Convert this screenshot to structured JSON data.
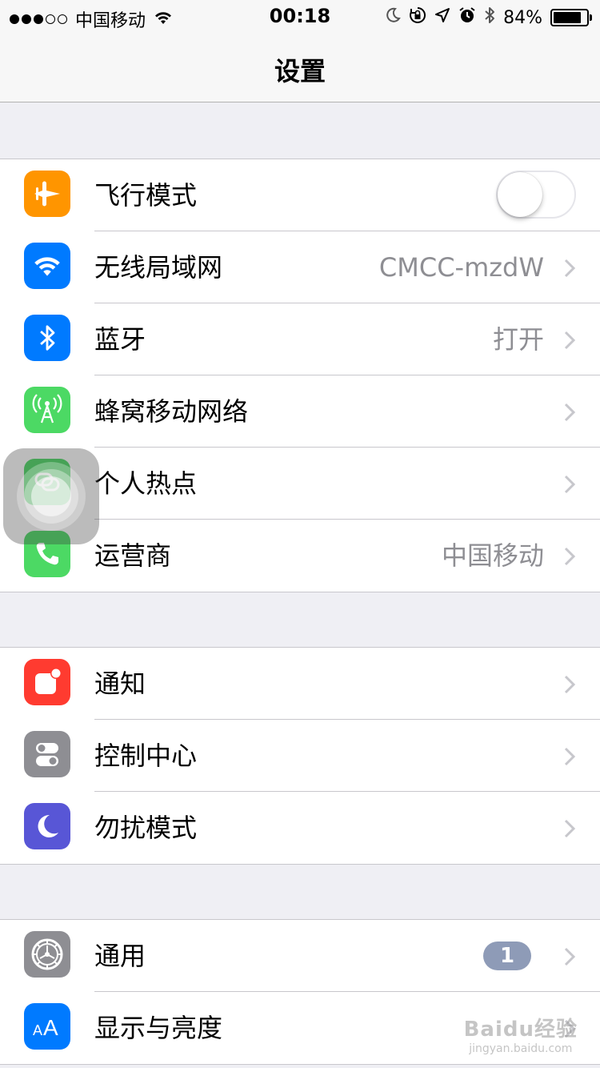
{
  "status_bar": {
    "carrier": "中国移动",
    "time": "00:18",
    "battery": "84%",
    "battery_level": 0.84,
    "signal_bars_filled": 3,
    "signal_bars_total": 5,
    "icons": [
      "wifi-icon",
      "moon-icon",
      "orientation-lock-icon",
      "location-icon",
      "alarm-icon",
      "bluetooth-icon",
      "battery-icon"
    ]
  },
  "nav": {
    "title": "设置"
  },
  "groups": [
    {
      "rows": [
        {
          "label": "飞行模式",
          "icon": "airplane-icon",
          "color": "#ff9500",
          "toggle": false
        },
        {
          "label": "无线局域网",
          "icon": "wifi-icon",
          "color": "#007aff",
          "value": "CMCC-mzdW"
        },
        {
          "label": "蓝牙",
          "icon": "bluetooth-icon",
          "color": "#007aff",
          "value": "打开"
        },
        {
          "label": "蜂窝移动网络",
          "icon": "cellular-icon",
          "color": "#4cd964"
        },
        {
          "label": "个人热点",
          "icon": "hotspot-icon",
          "color": "#4cd964"
        },
        {
          "label": "运营商",
          "icon": "phone-icon",
          "color": "#4cd964",
          "value": "中国移动"
        }
      ]
    },
    {
      "rows": [
        {
          "label": "通知",
          "icon": "notifications-icon",
          "color": "#ff3b30"
        },
        {
          "label": "控制中心",
          "icon": "control-center-icon",
          "color": "#8e8e93"
        },
        {
          "label": "勿扰模式",
          "icon": "moon-icon",
          "color": "#5856d6"
        }
      ]
    },
    {
      "rows": [
        {
          "label": "通用",
          "icon": "gear-icon",
          "color": "#8e8e93",
          "badge": "1"
        },
        {
          "label": "显示与亮度",
          "icon": "display-icon",
          "color": "#007aff"
        }
      ]
    }
  ],
  "watermark": {
    "line1": "Baidu经验",
    "line2": "jingyan.baidu.com"
  }
}
